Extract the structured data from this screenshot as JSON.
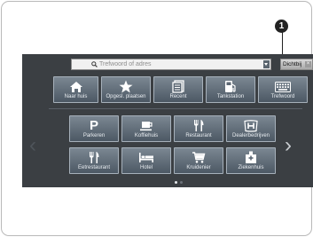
{
  "callout": {
    "number": "1"
  },
  "search": {
    "placeholder": "Trefwoord of adres"
  },
  "close_button": {
    "label": "Dichtbij",
    "x_glyph": "×"
  },
  "quick_row": [
    {
      "label": "Naar huis",
      "icon": "home-icon"
    },
    {
      "label": "Opgesl. plaatsen",
      "icon": "star-icon"
    },
    {
      "label": "Recent",
      "icon": "recent-list-icon"
    },
    {
      "label": "Tankstation",
      "icon": "fuel-pump-icon"
    },
    {
      "label": "Trefwoord",
      "icon": "keyboard-icon"
    }
  ],
  "categories": [
    {
      "label": "Parkeren",
      "icon": "parking-icon",
      "glyph": "P"
    },
    {
      "label": "Koffiehuis",
      "icon": "coffee-icon"
    },
    {
      "label": "Restaurant",
      "icon": "fork-knife-icon"
    },
    {
      "label": "Dealerbedrijven",
      "icon": "honda-logo-icon"
    },
    {
      "label": "Eetrestaurant",
      "icon": "fork-knife-icon"
    },
    {
      "label": "Hotel",
      "icon": "bed-icon"
    },
    {
      "label": "Kruidenier",
      "icon": "shopping-cart-icon"
    },
    {
      "label": "Ziekenhuis",
      "icon": "hospital-icon"
    }
  ],
  "nav": {
    "prev": "‹",
    "next": "›"
  },
  "pagination": {
    "pages": 2,
    "current": 1
  }
}
